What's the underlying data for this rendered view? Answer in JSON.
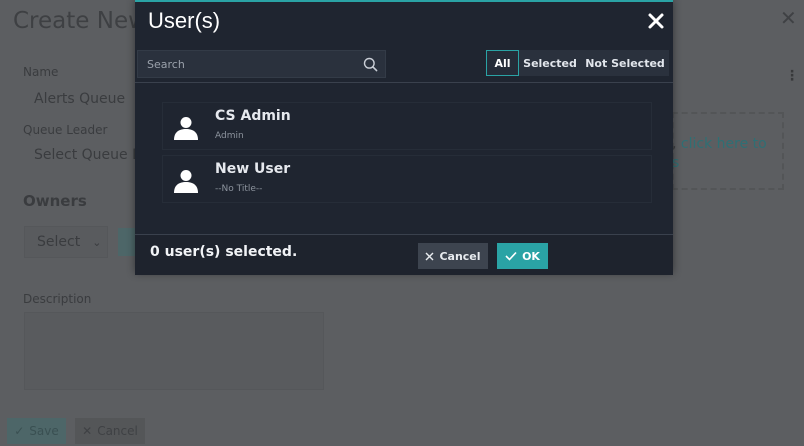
{
  "background": {
    "title": "Create New",
    "name_label": "Name",
    "name_value": "Alerts Queue",
    "leader_label": "Queue Leader",
    "leader_value": "Select Queue Le",
    "owners_label": "Owners",
    "owners_select": "Select",
    "description_label": "Description",
    "link_prefix": ",",
    "link_text": "click here to",
    "link_text2": "s",
    "save_label": "Save",
    "cancel_label": "Cancel"
  },
  "modal": {
    "title": "User(s)",
    "search": {
      "placeholder": "Search"
    },
    "filters": {
      "all": "All",
      "selected": "Selected",
      "not_selected": "Not Selected",
      "active": "All"
    },
    "users": [
      {
        "name": "CS Admin",
        "subtitle": "Admin"
      },
      {
        "name": "New User",
        "subtitle": "--No Title--"
      }
    ],
    "footer": {
      "selected_count": "0 user(s) selected.",
      "cancel_label": "Cancel",
      "ok_label": "OK"
    }
  },
  "colors": {
    "accent": "#2aa3a5",
    "modal_bg": "#1f2530",
    "overlay": "#5c5e61"
  },
  "icons": [
    "close-icon",
    "search-icon",
    "user-icon",
    "check-icon"
  ]
}
